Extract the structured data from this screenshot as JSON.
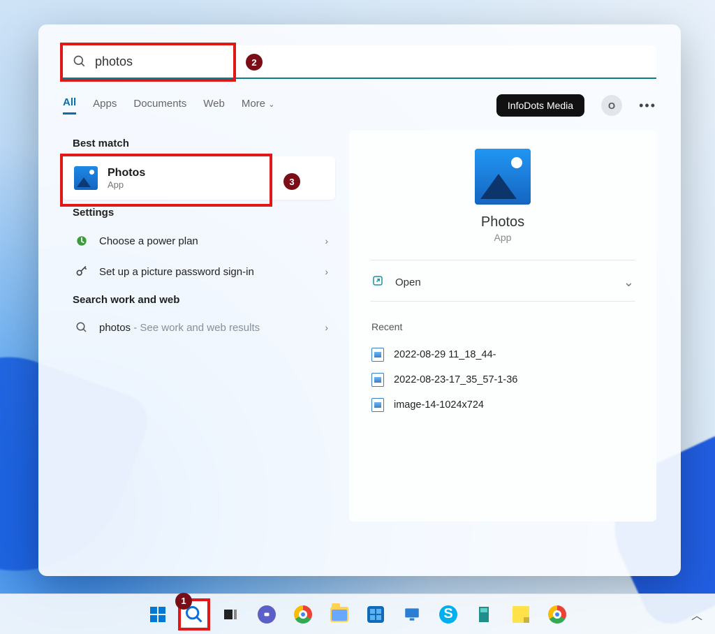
{
  "search": {
    "query": "photos"
  },
  "tabs": [
    "All",
    "Apps",
    "Documents",
    "Web",
    "More"
  ],
  "account": {
    "name": "InfoDots Media",
    "initial": "O"
  },
  "left": {
    "best_match_heading": "Best match",
    "best_match": {
      "title": "Photos",
      "subtitle": "App"
    },
    "settings_heading": "Settings",
    "settings": [
      {
        "label": "Choose a power plan",
        "icon": "power-plan-icon"
      },
      {
        "label": "Set up a picture password sign-in",
        "icon": "key-icon"
      }
    ],
    "web_heading": "Search work and web",
    "web": {
      "term": "photos",
      "hint": "See work and web results"
    }
  },
  "detail": {
    "title": "Photos",
    "subtitle": "App",
    "open_label": "Open",
    "recent_heading": "Recent",
    "recent": [
      "2022-08-29 11_18_44-",
      "2022-08-23-17_35_57-1-36",
      "image-14-1024x724"
    ]
  },
  "steps": {
    "1": "1",
    "2": "2",
    "3": "3"
  },
  "colors": {
    "annotation_red": "#e01818",
    "step_badge": "#7a0d15",
    "accent": "#0a7d8c"
  }
}
